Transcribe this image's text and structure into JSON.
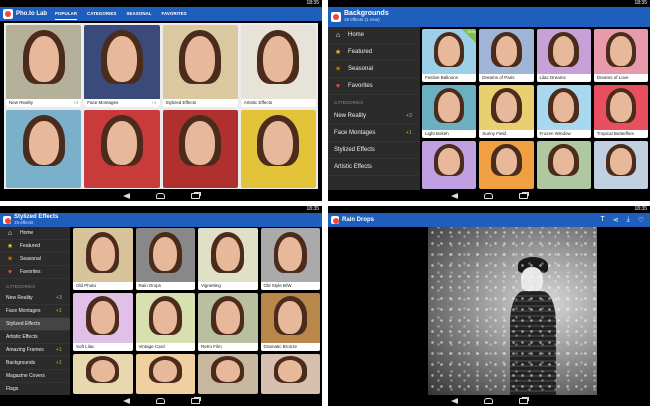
{
  "status": {
    "time": "18:35"
  },
  "p1": {
    "app_title": "Pho.to Lab",
    "tabs": [
      "POPULAR",
      "CATEGORIES",
      "SEASONAL",
      "FAVORITES"
    ],
    "active_tab": 0,
    "cards": [
      {
        "label": "New Reality",
        "count": "+3",
        "bg": "#b5b09a"
      },
      {
        "label": "Face Montages",
        "count": "+1",
        "bg": "#3a4a7a"
      },
      {
        "label": "Stylized Effects",
        "count": "",
        "bg": "#d9c8a0"
      },
      {
        "label": "Artistic Effects",
        "count": "",
        "bg": "#e8e3d8"
      },
      {
        "label": "",
        "count": "",
        "bg": "#7ab0c9"
      },
      {
        "label": "",
        "count": "",
        "bg": "#c93a3a"
      },
      {
        "label": "",
        "count": "",
        "bg": "#b03030"
      },
      {
        "label": "",
        "count": "",
        "bg": "#e2c33a"
      }
    ]
  },
  "p2": {
    "title": "Backgrounds",
    "subtitle": "19 effects (1 new)",
    "drawer": {
      "items": [
        {
          "label": "Home",
          "icon": "home-icon",
          "glyph": "⌂",
          "color": "#fff"
        },
        {
          "label": "Featured",
          "icon": "star-icon",
          "glyph": "★",
          "color": "#f1c40f"
        },
        {
          "label": "Seasonal",
          "icon": "sun-icon",
          "glyph": "☀",
          "color": "#f39c12"
        },
        {
          "label": "Favorites",
          "icon": "heart-icon",
          "glyph": "♥",
          "color": "#e74c3c"
        }
      ],
      "categories_label": "CATEGORIES",
      "categories": [
        {
          "label": "New Reality",
          "count": "+3"
        },
        {
          "label": "Face Montages",
          "count": "+1"
        },
        {
          "label": "Stylized Effects",
          "count": ""
        },
        {
          "label": "Artistic Effects",
          "count": ""
        }
      ]
    },
    "effects": [
      {
        "label": "Festive Balloons",
        "bg": "#9bd0e8",
        "new": true
      },
      {
        "label": "Dreams of Paris",
        "bg": "#9fb4d6"
      },
      {
        "label": "Lilac Dreams",
        "bg": "#c8a0d8"
      },
      {
        "label": "Dreams of Love",
        "bg": "#e89aaa"
      },
      {
        "label": "Light Bokeh",
        "bg": "#6ab0c0"
      },
      {
        "label": "Sunny Field",
        "bg": "#e8d070"
      },
      {
        "label": "Frozen Window",
        "bg": "#a8d8f0"
      },
      {
        "label": "Tropical Butterflies",
        "bg": "#e85060"
      },
      {
        "label": "",
        "bg": "#c0a0e0"
      },
      {
        "label": "",
        "bg": "#f0a040"
      },
      {
        "label": "",
        "bg": "#b0c8a0"
      },
      {
        "label": "",
        "bg": "#c0d0e0"
      }
    ],
    "new_badge": "NEW"
  },
  "p3": {
    "title": "Stylized Effects",
    "subtitle": "19 effects",
    "drawer": {
      "items": [
        {
          "label": "Home",
          "icon": "home-icon",
          "glyph": "⌂",
          "color": "#fff"
        },
        {
          "label": "Featured",
          "icon": "star-icon",
          "glyph": "★",
          "color": "#f1c40f"
        },
        {
          "label": "Seasonal",
          "icon": "sun-icon",
          "glyph": "☀",
          "color": "#f39c12"
        },
        {
          "label": "Favorites",
          "icon": "heart-icon",
          "glyph": "♥",
          "color": "#e74c3c"
        }
      ],
      "categories_label": "CATEGORIES",
      "categories": [
        {
          "label": "New Reality",
          "count": "+3"
        },
        {
          "label": "Face Montages",
          "count": "+1"
        },
        {
          "label": "Stylized Effects",
          "count": "",
          "sel": true
        },
        {
          "label": "Artistic Effects",
          "count": ""
        },
        {
          "label": "Amazing Frames",
          "count": "+1"
        },
        {
          "label": "Backgrounds",
          "count": "+1"
        },
        {
          "label": "Magazine Covers",
          "count": ""
        },
        {
          "label": "Flags",
          "count": ""
        }
      ]
    },
    "effects": [
      {
        "label": "Old Photo",
        "bg": "#d8c49a"
      },
      {
        "label": "Rain Drops",
        "bg": "#888"
      },
      {
        "label": "Vignetting",
        "bg": "#e0e0c8"
      },
      {
        "label": "Old Style B/W",
        "bg": "#aaa"
      },
      {
        "label": "Soft Lilac",
        "bg": "#e0c0e8"
      },
      {
        "label": "Vintage Card",
        "bg": "#d8e0b0"
      },
      {
        "label": "Retro Film",
        "bg": "#b8c0a0"
      },
      {
        "label": "Dramatic Bronze",
        "bg": "#b8884a"
      },
      {
        "label": "",
        "bg": "#e8d8b0"
      },
      {
        "label": "",
        "bg": "#f0d0a0"
      },
      {
        "label": "",
        "bg": "#c8b8a0"
      },
      {
        "label": "",
        "bg": "#d8c0b0"
      }
    ]
  },
  "p4": {
    "title": "Rain Drops",
    "actions": [
      {
        "name": "text-icon",
        "glyph": "T"
      },
      {
        "name": "share-icon",
        "glyph": "⋖"
      },
      {
        "name": "download-icon",
        "glyph": "⤓"
      },
      {
        "name": "heart-outline-icon",
        "glyph": "♡"
      }
    ]
  }
}
